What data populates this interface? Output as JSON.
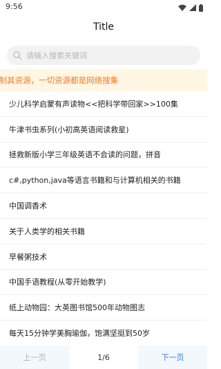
{
  "status": {
    "time": "9:56"
  },
  "header": {
    "title": "Title"
  },
  "search": {
    "placeholder": "请输入搜索关键词"
  },
  "notice": {
    "text": "!制其资源，一切资源都是网络搜集"
  },
  "list": {
    "items": [
      "少儿科学启蒙有声读物<<把科学带回家>>100集",
      "牛津书虫系列(小初高英语阅读救星)",
      "拯救新版小学三年级英语不会读的问题，拼音",
      "c#,python,java等语言书籍和与计算机相关的书籍",
      "中国调香术",
      "关于人类学的相关书籍",
      "早餐粥技术",
      "中国手语教程(从零开始教学)",
      "纸上动物园：大英图书馆500年动物图志",
      "每天15分钟学美胸瑜伽，饱满坚挺到50岁"
    ]
  },
  "pager": {
    "prev_label": "上一页",
    "page_label": "1/6",
    "next_label": "下一页"
  },
  "colors": {
    "notice_bg": "#fff6e3",
    "notice_text": "#f07d2a",
    "accent": "#2d7fe0"
  }
}
